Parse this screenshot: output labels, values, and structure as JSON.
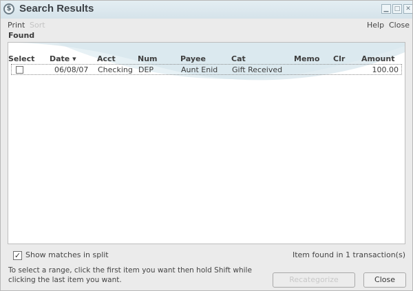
{
  "window": {
    "title": "Search Results"
  },
  "menu": {
    "print": "Print",
    "sort": "Sort",
    "help": "Help",
    "close": "Close"
  },
  "found_label": "Found",
  "columns": [
    "Select",
    "Date ▾",
    "Acct",
    "Num",
    "Payee",
    "Cat",
    "Memo",
    "Clr",
    "Amount"
  ],
  "rows": [
    {
      "selected": false,
      "date": "06/08/07",
      "acct": "Checking",
      "num": "DEP",
      "payee": "Aunt Enid",
      "cat": "Gift Received",
      "memo": "",
      "clr": "",
      "amount": "100.00"
    }
  ],
  "show_matches": {
    "label": "Show matches in split",
    "checked": true
  },
  "status": "Item found in 1 transaction(s)",
  "hint": "To select a range, click the first item you want then hold Shift while clicking the last item you want.",
  "buttons": {
    "recategorize": "Recategorize",
    "close": "Close"
  },
  "colors": {
    "titlebar": "#d5e3ea",
    "panel": "#ebebeb",
    "accent": "#c9dde6"
  }
}
